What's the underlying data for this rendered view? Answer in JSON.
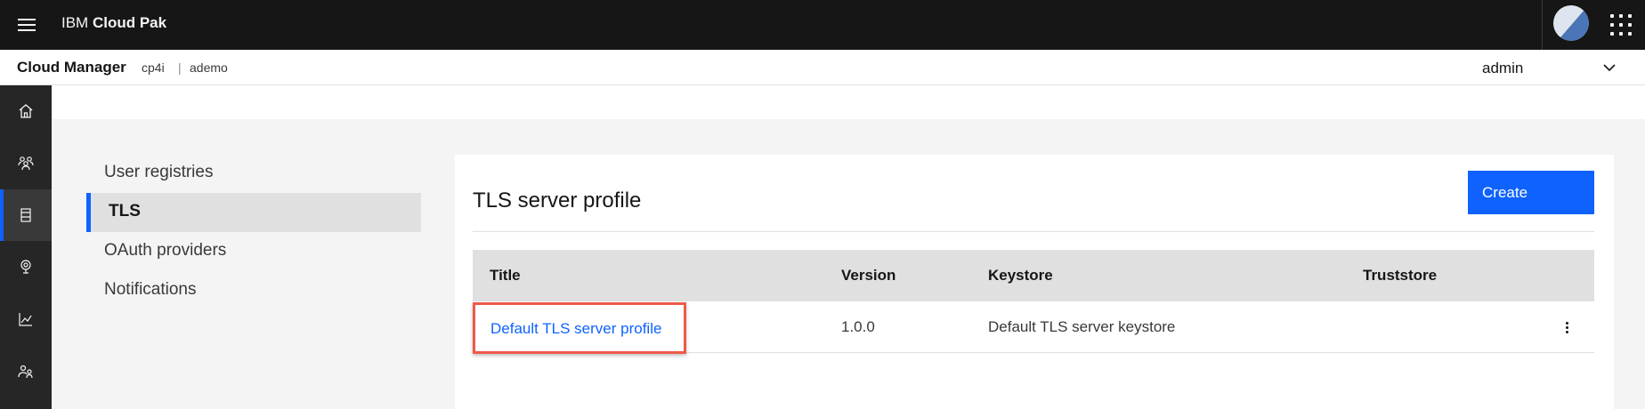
{
  "header": {
    "brand_prefix": "IBM",
    "brand_name": "Cloud Pak",
    "icons": [
      "menu-icon",
      "avatar",
      "app-switcher-icon"
    ]
  },
  "subheader": {
    "app_name": "Cloud Manager",
    "crumb_1": "cp4i",
    "separator": "|",
    "crumb_2": "ademo",
    "user": "admin"
  },
  "rail": {
    "items": [
      "home-icon",
      "users-icon",
      "resources-icon",
      "topology-icon",
      "analytics-icon",
      "members-icon"
    ],
    "active": "resources-icon"
  },
  "settings_nav": {
    "items": [
      {
        "label": "User registries",
        "active": false
      },
      {
        "label": "TLS",
        "active": true
      },
      {
        "label": "OAuth providers",
        "active": false
      },
      {
        "label": "Notifications",
        "active": false
      }
    ]
  },
  "panel": {
    "title": "TLS server profile",
    "create_label": "Create",
    "columns": [
      "Title",
      "Version",
      "Keystore",
      "Truststore"
    ],
    "rows": [
      {
        "title": "Default TLS server profile",
        "version": "1.0.0",
        "keystore": "Default TLS server keystore",
        "truststore": ""
      }
    ]
  },
  "colors": {
    "accent": "#0f62fe",
    "highlight": "#ee5a4a",
    "header_bg": "#161616",
    "rail_bg": "#262626"
  }
}
